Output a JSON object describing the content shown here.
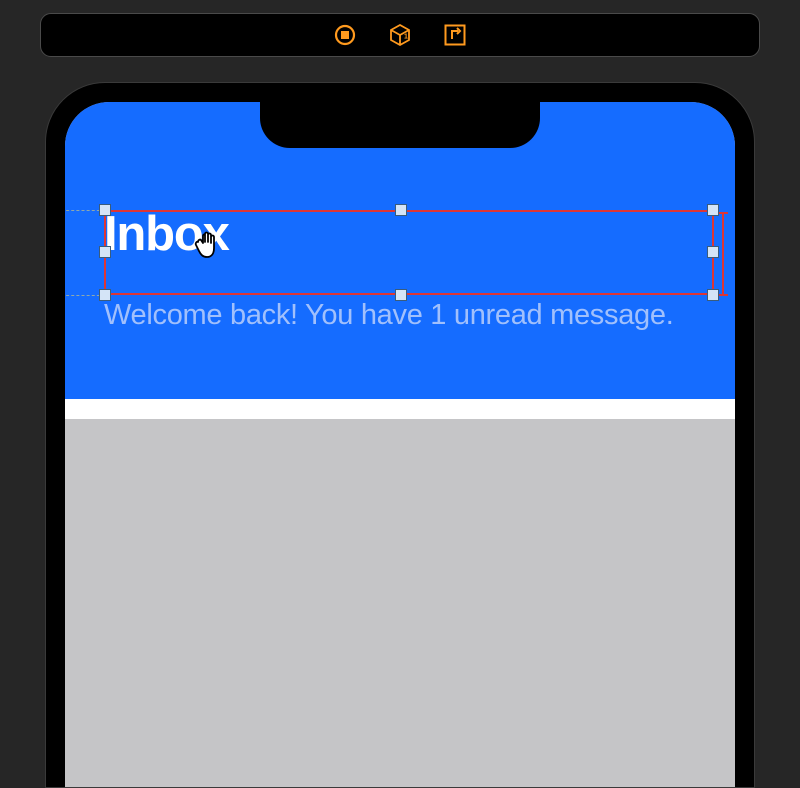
{
  "toolbar": {
    "icons": {
      "stop": "stop-icon",
      "package": "package-icon",
      "export": "export-icon"
    }
  },
  "header": {
    "title": "Inbox",
    "subtitle": "Welcome back! You have 1 unread message."
  },
  "colors": {
    "background": "#262626",
    "toolbar_bg": "#000000",
    "toolbar_border": "#4a4a4a",
    "phone_frame": "#000000",
    "blue_header": "#156cff",
    "gray_area": "#c5c5c7",
    "white_divider": "#ffffff",
    "title_text": "#ffffff",
    "subtitle_text": "#a1c0fc",
    "selection": "#dd3636",
    "handle_fill": "#d4e4f7",
    "handle_border": "#3a5c7c",
    "icon_orange": "#ff9a1e"
  }
}
